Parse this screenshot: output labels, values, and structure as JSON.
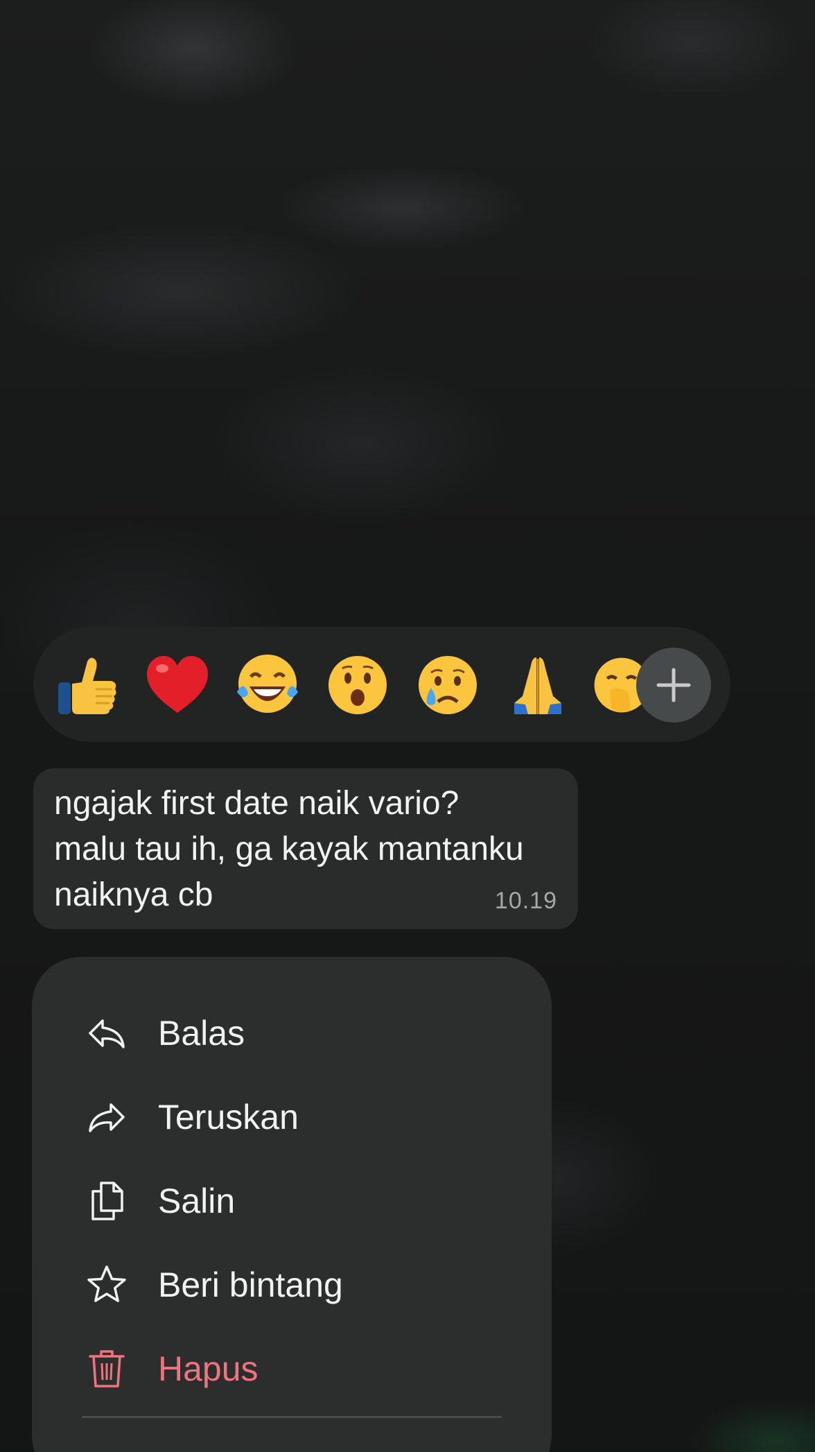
{
  "reactions": [
    {
      "name": "thumbs-up",
      "emoji": "👍"
    },
    {
      "name": "red-heart",
      "emoji": "❤️"
    },
    {
      "name": "face-with-tears-of-joy",
      "emoji": "😂"
    },
    {
      "name": "face-with-open-mouth",
      "emoji": "😮"
    },
    {
      "name": "crying-face",
      "emoji": "😢"
    },
    {
      "name": "folded-hands",
      "emoji": "🙏"
    },
    {
      "name": "face-with-hand-over-mouth",
      "emoji": "🫢"
    }
  ],
  "add_reaction": {
    "icon": "plus-icon"
  },
  "message": {
    "text": "ngajak first date naik vario?\nmalu tau ih, ga kayak mantanku\nnaiknya cb",
    "time": "10.19"
  },
  "menu": {
    "items": [
      {
        "label": "Balas",
        "icon": "reply-icon"
      },
      {
        "label": "Teruskan",
        "icon": "forward-icon"
      },
      {
        "label": "Salin",
        "icon": "copy-icon"
      },
      {
        "label": "Beri bintang",
        "icon": "star-icon"
      },
      {
        "label": "Hapus",
        "icon": "trash-icon",
        "color": "#f0737f"
      }
    ]
  },
  "colors": {
    "background": "#141515",
    "reaction_bar": "#222424",
    "bubble": "#2a2c2c",
    "menu": "#2c2e2e",
    "danger": "#f0737f"
  }
}
